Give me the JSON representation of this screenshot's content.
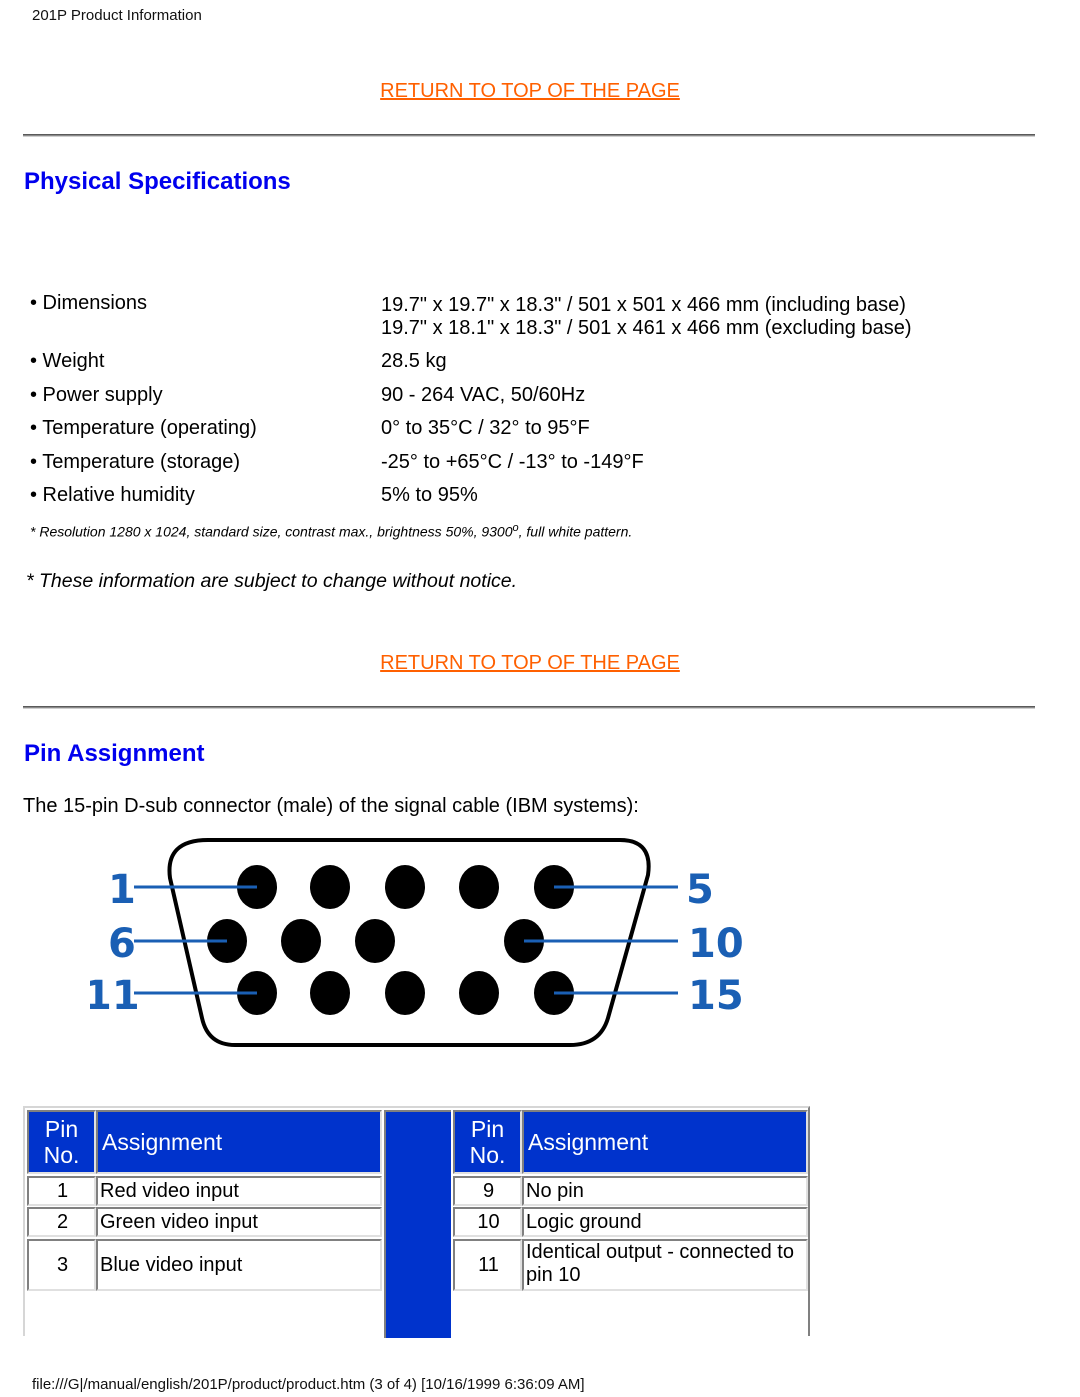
{
  "header": {
    "title": "201P Product Information"
  },
  "nav": {
    "return_top_label": "RETURN TO TOP OF THE PAGE"
  },
  "physical": {
    "title": "Physical Specifications",
    "specs": [
      {
        "label": "• Dimensions",
        "value": "19.7\" x 19.7\" x 18.3\" / 501 x 501 x 466 mm (including base)",
        "value2": "19.7\" x 18.1\" x 18.3\" / 501 x 461 x 466 mm (excluding base)"
      },
      {
        "label": "• Weight",
        "value": "28.5 kg"
      },
      {
        "label": "• Power supply",
        "value": "90 - 264 VAC, 50/60Hz"
      },
      {
        "label": "• Temperature (operating)",
        "value": "0° to 35°C / 32° to 95°F"
      },
      {
        "label": "• Temperature (storage)",
        "value": "-25° to +65°C / -13° to -149°F"
      },
      {
        "label": "• Relative humidity",
        "value": "5% to 95%"
      }
    ],
    "footnote_main": "* Resolution 1280 x 1024, standard size, contrast max., brightness 50%, 9300",
    "footnote_sup": "o",
    "footnote_end": ", full white pattern.",
    "notice": "* These information are subject to change without notice."
  },
  "pin": {
    "title": "Pin Assignment",
    "intro": "The 15-pin D-sub connector (male) of the signal cable (IBM systems):",
    "diagram": {
      "labels": {
        "top_left": "1",
        "top_right": "5",
        "mid_left": "6",
        "mid_right": "10",
        "bot_left": "11",
        "bot_right": "15"
      },
      "colors": {
        "label": "#1a5fb4",
        "pin": "#000000",
        "shell": "#000000"
      }
    },
    "table": {
      "header_pin": [
        "Pin",
        "No."
      ],
      "header_assignment": "Assignment",
      "left_rows": [
        {
          "pin": "1",
          "assignment": "Red video input"
        },
        {
          "pin": "2",
          "assignment": "Green video input"
        },
        {
          "pin": "3",
          "assignment": "Blue video input"
        }
      ],
      "right_rows": [
        {
          "pin": "9",
          "assignment": "No pin"
        },
        {
          "pin": "10",
          "assignment": "Logic ground"
        },
        {
          "pin": "11",
          "assignment": "Identical output - connected to pin 10"
        }
      ],
      "header_color": "#0033cc"
    }
  },
  "footer": {
    "text": "file:///G|/manual/english/201P/product/product.htm (3 of 4) [10/16/1999 6:36:09 AM]"
  }
}
